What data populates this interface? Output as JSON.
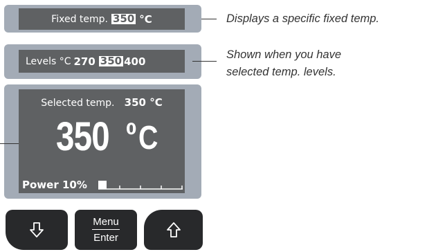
{
  "panels": {
    "fixed": {
      "label": "Fixed temp.",
      "value": "350",
      "unit": "°C"
    },
    "levels": {
      "label": "Levels °C",
      "level_low": "270",
      "level_selected": "350",
      "level_high": "400"
    },
    "main": {
      "selected_label": "Selected temp.",
      "selected_value": "350 °C",
      "big_value": "350",
      "big_unit_deg": "0",
      "big_unit_c": "C",
      "power_label": "Power 10%",
      "power_fraction": 0.1
    }
  },
  "descriptions": {
    "fixed": "Displays a specific fixed temp.",
    "levels_line1": "Shown when you have",
    "levels_line2": "selected temp. levels."
  },
  "buttons": {
    "down_icon": "arrow-down-icon",
    "menu_top": "Menu",
    "menu_bottom": "Enter",
    "up_icon": "arrow-up-icon"
  },
  "colors": {
    "bezel": "#a3abb6",
    "lcd": "#5f6163",
    "button": "#28292b"
  }
}
